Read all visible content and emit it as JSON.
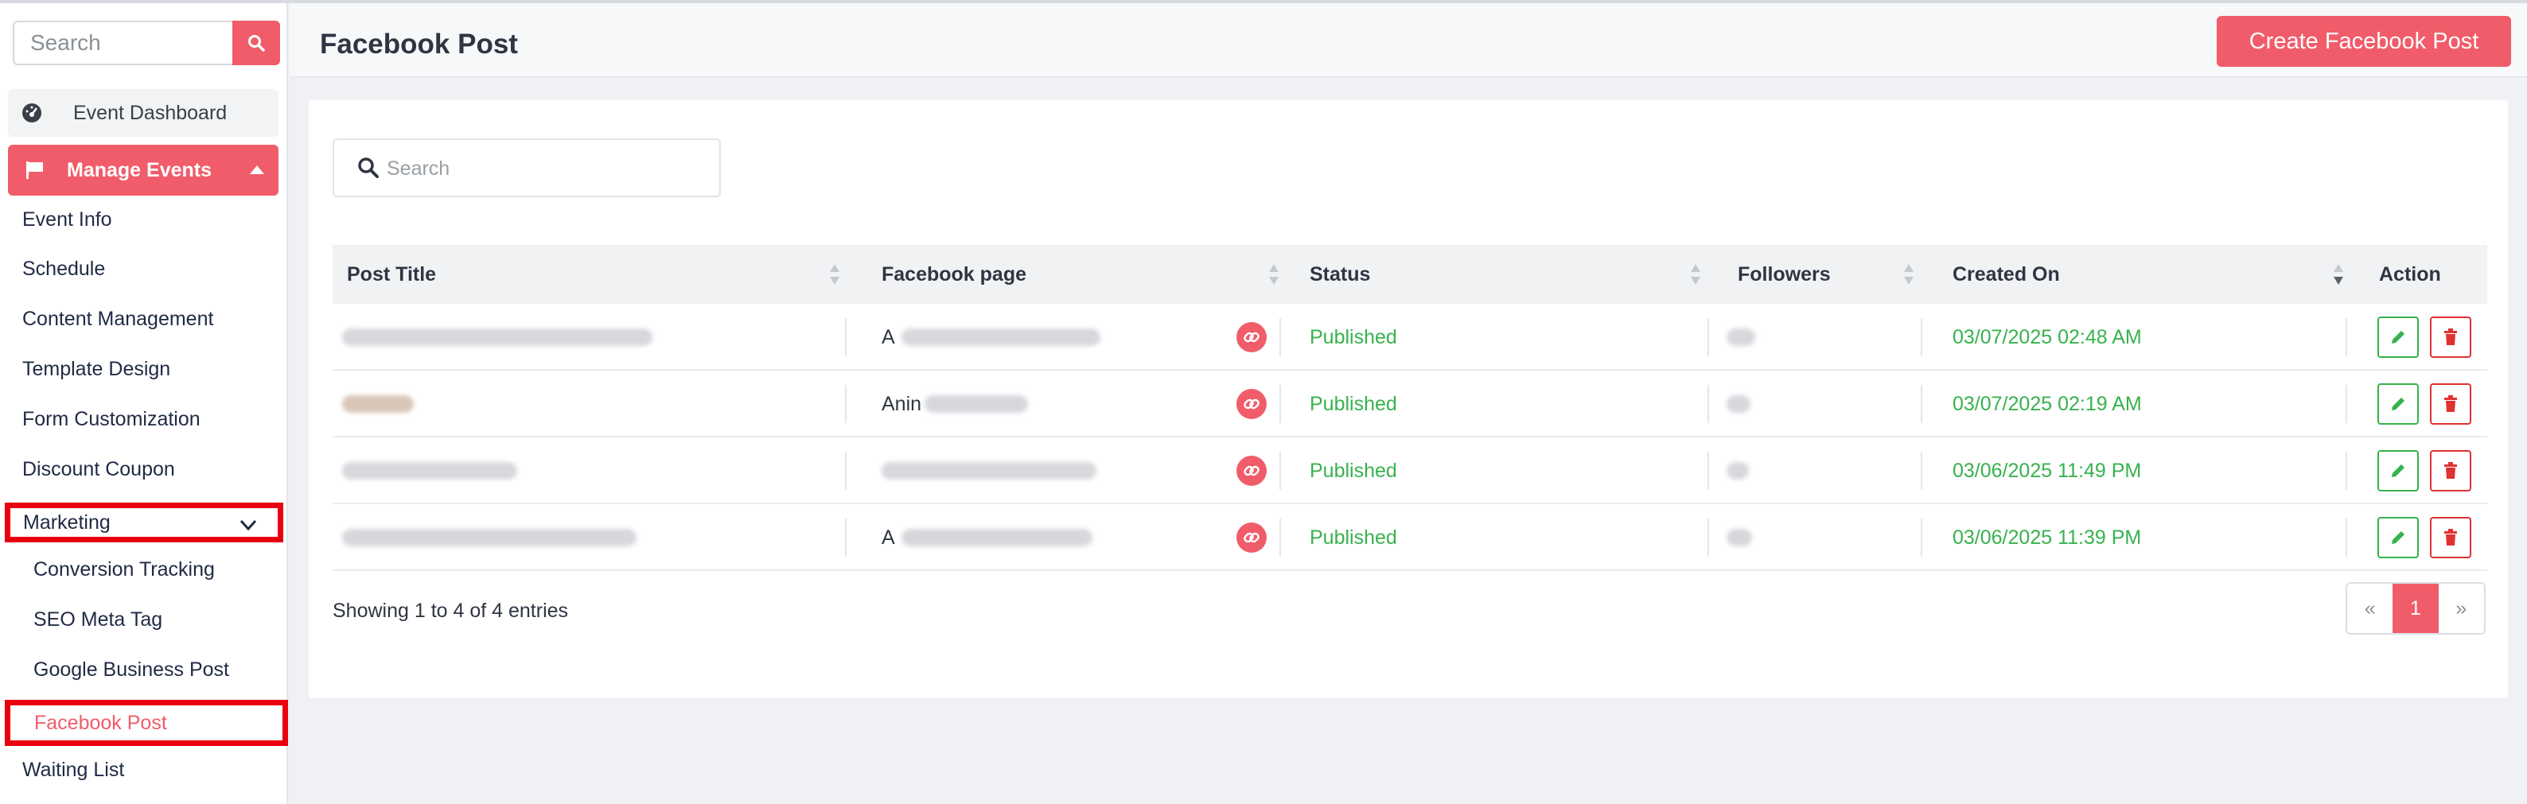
{
  "sidebar": {
    "search_placeholder": "Search",
    "dashboard_label": "Event Dashboard",
    "manage_label": "Manage Events",
    "items": [
      "Event Info",
      "Schedule",
      "Content Management",
      "Template Design",
      "Form Customization",
      "Discount Coupon"
    ],
    "marketing_label": "Marketing",
    "marketing_sub": [
      "Conversion Tracking",
      "SEO Meta Tag",
      "Google Business Post"
    ],
    "active_label": "Facebook Post",
    "waiting_label": "Waiting List"
  },
  "header": {
    "title": "Facebook Post",
    "create_label": "Create Facebook Post"
  },
  "table": {
    "search_placeholder": "Search",
    "columns": [
      "Post Title",
      "Facebook page",
      "Status",
      "Followers",
      "Created On",
      "Action"
    ],
    "rows": [
      {
        "page_text": "A",
        "status": "Published",
        "created": "03/07/2025 02:48 AM"
      },
      {
        "page_text": "Anin",
        "status": "Published",
        "created": "03/07/2025 02:19 AM"
      },
      {
        "page_text": "",
        "status": "Published",
        "created": "03/06/2025 11:49 PM"
      },
      {
        "page_text": "A",
        "status": "Published",
        "created": "03/06/2025 11:39 PM"
      }
    ],
    "showing": "Showing 1 to 4 of 4 entries",
    "pager": {
      "prev": "«",
      "current": "1",
      "next": "»"
    }
  },
  "colors": {
    "accent": "#f15c6a",
    "success": "#37b24d",
    "danger": "#e03131",
    "highlight": "#e8000e"
  }
}
